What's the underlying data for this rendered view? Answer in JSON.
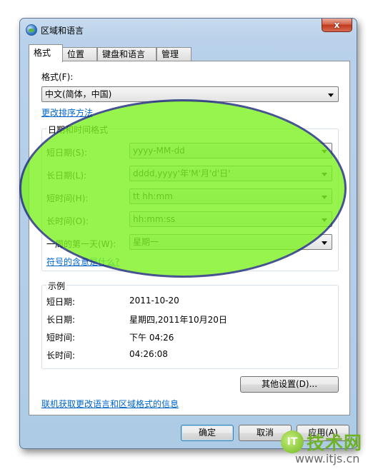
{
  "window": {
    "title": "区域和语言",
    "close_glyph": "x"
  },
  "tabs": [
    {
      "label": "格式",
      "active": true
    },
    {
      "label": "位置",
      "active": false
    },
    {
      "label": "键盘和语言",
      "active": false
    },
    {
      "label": "管理",
      "active": false
    }
  ],
  "format": {
    "label": "格式(F):",
    "value": "中文(简体，中国)",
    "sort_link": "更改排序方法"
  },
  "datetime_group": {
    "title": "日期和时间格式",
    "rows": [
      {
        "label": "短日期(S):",
        "value": "yyyy-MM-dd"
      },
      {
        "label": "长日期(L):",
        "value": "dddd,yyyy'年'M'月'd'日'"
      },
      {
        "label": "短时间(H):",
        "value": "tt hh:mm"
      },
      {
        "label": "长时间(O):",
        "value": "hh:mm:ss"
      },
      {
        "label": "一周的第一天(W):",
        "value": "星期一"
      }
    ],
    "help_link": "符号的含意是什么?"
  },
  "example_group": {
    "title": "示例",
    "rows": [
      {
        "label": "短日期:",
        "value": "2011-10-20"
      },
      {
        "label": "长日期:",
        "value": "星期四,2011年10月20日"
      },
      {
        "label": "短时间:",
        "value": "下午 04:26"
      },
      {
        "label": "长时间:",
        "value": "04:26:08"
      }
    ]
  },
  "other_settings_button": "其他设置(D)...",
  "online_link": "联机获取更改语言和区域格式的信息",
  "buttons": {
    "ok": "确定",
    "cancel": "取消",
    "apply": "应用(A)"
  },
  "watermark": {
    "logo": "IT",
    "text": "技术网",
    "url": "www.itjs.cn"
  },
  "colors": {
    "highlight_fill": "#7ff225",
    "highlight_border": "#1f2f7a",
    "link": "#0066cc",
    "close_button": "#c0391d"
  }
}
